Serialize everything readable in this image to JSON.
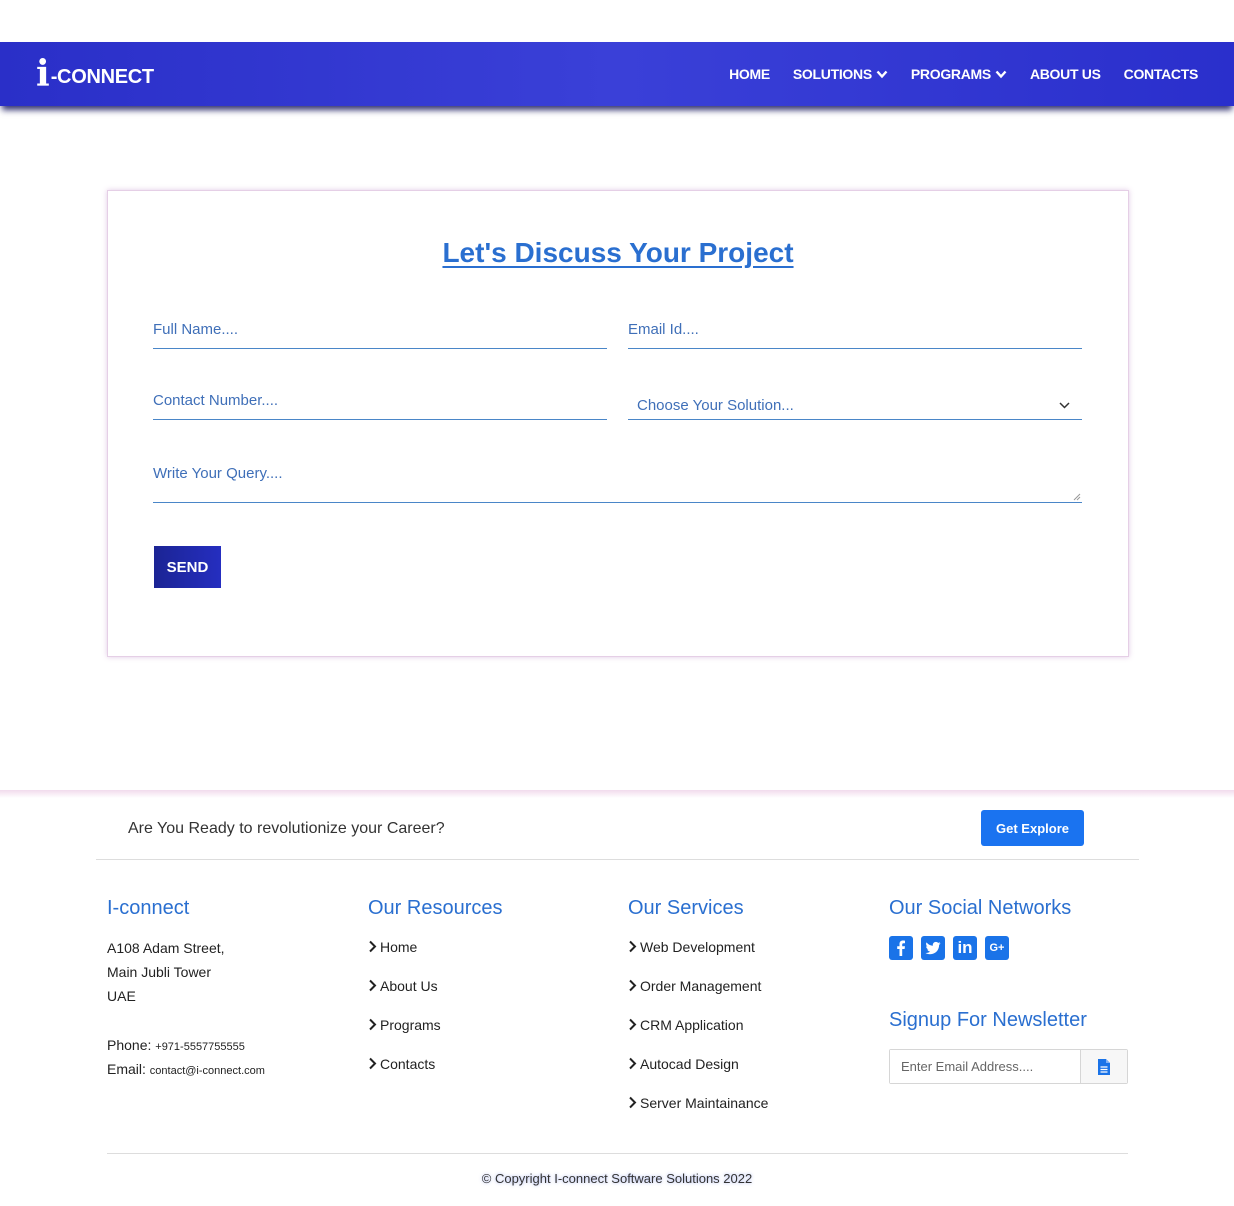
{
  "brand": {
    "logo_i": "i",
    "logo_rest": "-CONNECT"
  },
  "nav": {
    "items": [
      {
        "label": "HOME"
      },
      {
        "label": "SOLUTIONS"
      },
      {
        "label": "PROGRAMS"
      },
      {
        "label": "ABOUT US"
      },
      {
        "label": "CONTACTS"
      }
    ]
  },
  "form": {
    "title": "Let's Discuss Your Project",
    "full_name_placeholder": "Full Name....",
    "email_placeholder": "Email Id....",
    "contact_placeholder": "Contact Number....",
    "solution_selected": "Choose Your Solution...",
    "query_placeholder": "Write Your Query....",
    "send_label": "SEND"
  },
  "footer": {
    "cta_text": "Are You Ready to revolutionize your Career?",
    "cta_button": "Get Explore",
    "company": {
      "heading": "I-connect",
      "address_lines": [
        "A108 Adam Street,",
        "Main Jubli Tower",
        "UAE"
      ],
      "phone_label": "Phone:",
      "phone_value": "+971-5557755555",
      "email_label": "Email:",
      "email_value": "contact@i-connect.com"
    },
    "resources": {
      "heading": "Our Resources",
      "links": [
        "Home",
        "About Us",
        "Programs",
        "Contacts"
      ]
    },
    "services": {
      "heading": "Our Services",
      "links": [
        "Web Development",
        "Order Management",
        "CRM Application",
        "Autocad Design",
        "Server Maintainance"
      ]
    },
    "social": {
      "heading": "Our Social Networks",
      "icons": [
        "facebook-icon",
        "twitter-icon",
        "linkedin-icon",
        "google-plus-icon"
      ],
      "linkedin_text": "in",
      "google_text": "G+"
    },
    "newsletter": {
      "heading": "Signup For Newsletter",
      "placeholder": "Enter Email Address...."
    },
    "copyright": "© Copyright I-connect Software Solutions 2022"
  },
  "colors": {
    "nav_bg": "#2a2fc8",
    "accent": "#2a6fd0",
    "button_dark": "#1b2494",
    "button_blue": "#1a73f0"
  }
}
